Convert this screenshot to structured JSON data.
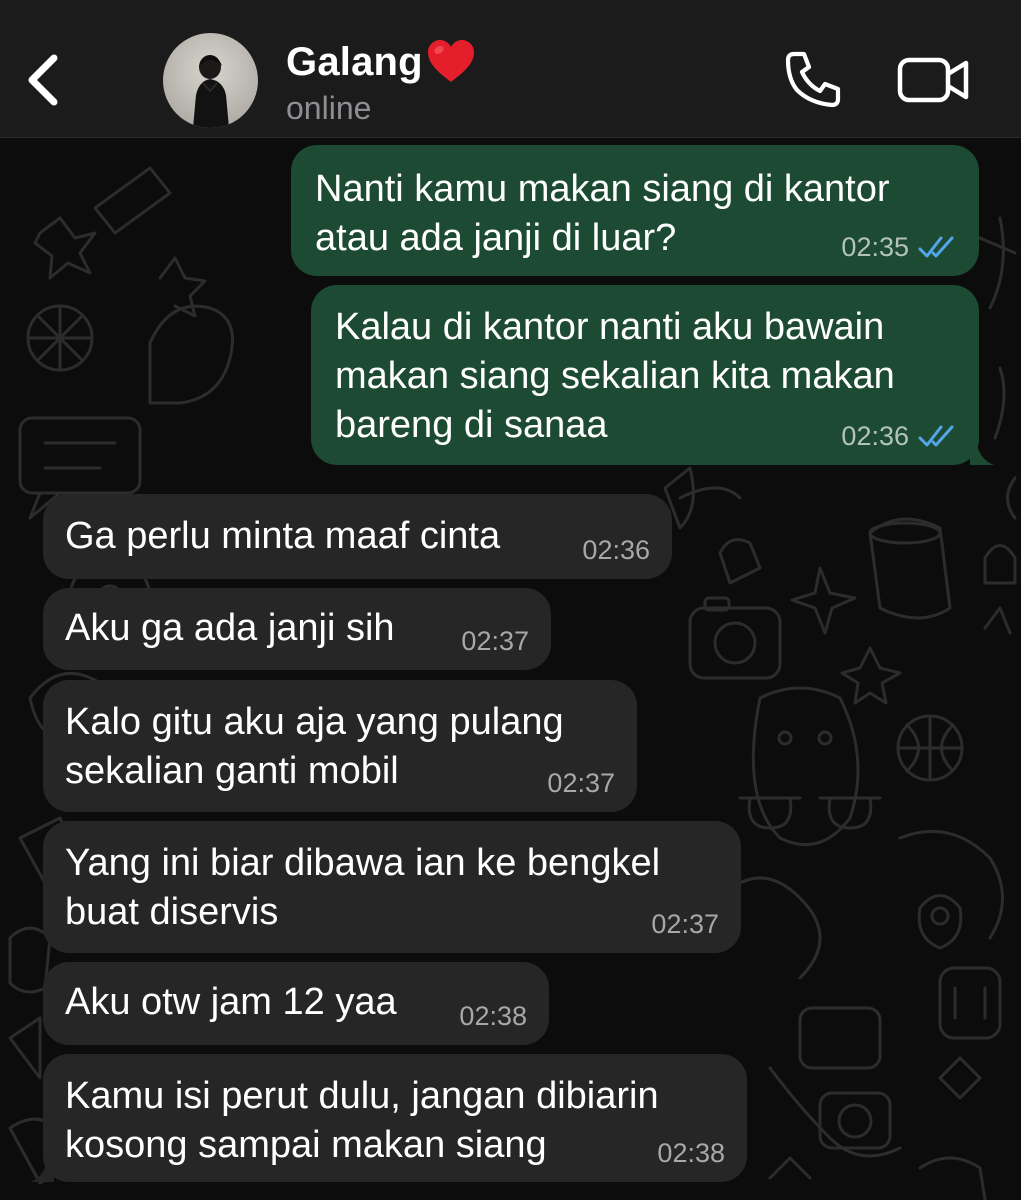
{
  "header": {
    "back_icon": "chevron-left-icon",
    "contact_name": "Galang",
    "name_emoji": "red-heart-icon",
    "status": "online",
    "call_icon": "phone-icon",
    "video_icon": "video-camera-icon"
  },
  "colors": {
    "header_bg": "#1b1b1c",
    "chat_bg": "#0c0c0c",
    "outgoing_bubble": "#1d4a33",
    "incoming_bubble": "#262627",
    "read_ticks": "#53a6e8",
    "status_text": "#8e8e93"
  },
  "messages": [
    {
      "direction": "outgoing",
      "text": "Nanti kamu makan siang di kantor\natau ada janji di luar?",
      "time": "02:35",
      "status": "read"
    },
    {
      "direction": "outgoing",
      "text": "Kalau di kantor nanti aku bawain\nmakan siang sekalian kita makan\nbareng di sanaa",
      "time": "02:36",
      "status": "read"
    },
    {
      "direction": "incoming",
      "text": "Ga perlu minta maaf cinta",
      "time": "02:36"
    },
    {
      "direction": "incoming",
      "text": "Aku ga ada janji sih",
      "time": "02:37"
    },
    {
      "direction": "incoming",
      "text": "Kalo gitu aku aja yang pulang\nsekalian ganti mobil",
      "time": "02:37"
    },
    {
      "direction": "incoming",
      "text": "Yang ini biar dibawa ian ke bengkel\nbuat diservis",
      "time": "02:37"
    },
    {
      "direction": "incoming",
      "text": "Aku otw jam 12 yaa",
      "time": "02:38"
    },
    {
      "direction": "incoming",
      "text": "Kamu isi perut dulu, jangan dibiarin\nkosong sampai makan siang",
      "time": "02:38"
    }
  ]
}
